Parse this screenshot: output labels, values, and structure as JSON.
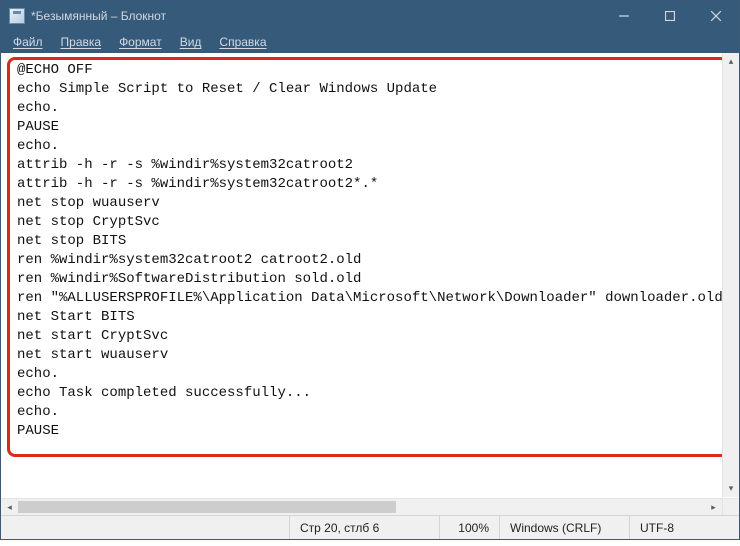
{
  "window": {
    "title": "*Безымянный – Блокнот"
  },
  "menu": {
    "file": "Файл",
    "edit": "Правка",
    "format": "Формат",
    "view": "Вид",
    "help": "Справка"
  },
  "editor": {
    "content": "@ECHO OFF\necho Simple Script to Reset / Clear Windows Update\necho.\nPAUSE\necho.\nattrib -h -r -s %windir%system32catroot2\nattrib -h -r -s %windir%system32catroot2*.*\nnet stop wuauserv\nnet stop CryptSvc\nnet stop BITS\nren %windir%system32catroot2 catroot2.old\nren %windir%SoftwareDistribution sold.old\nren \"%ALLUSERSPROFILE%\\Application Data\\Microsoft\\Network\\Downloader\" downloader.old\nnet Start BITS\nnet start CryptSvc\nnet start wuauserv\necho.\necho Task completed successfully...\necho.\nPAUSE"
  },
  "status": {
    "position": "Стр 20, стлб 6",
    "zoom": "100%",
    "eol": "Windows (CRLF)",
    "encoding": "UTF-8"
  }
}
